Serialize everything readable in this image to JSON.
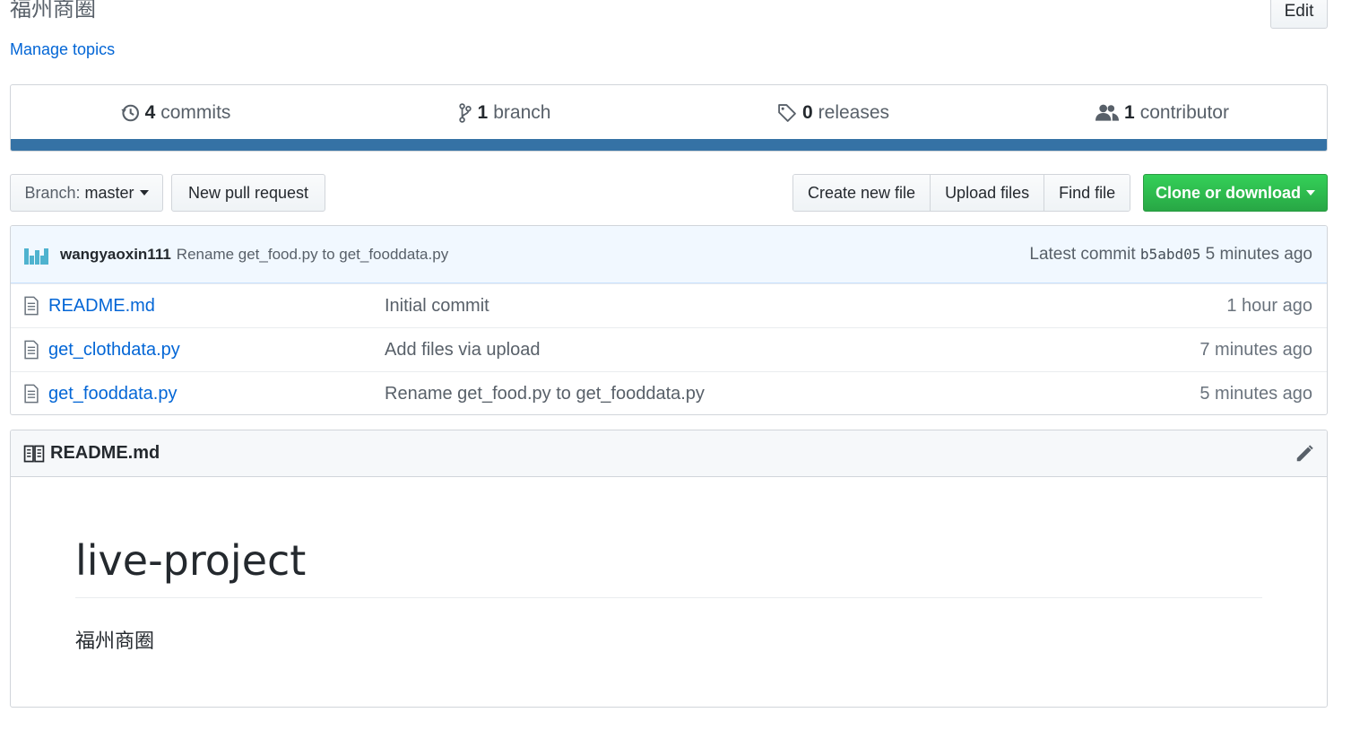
{
  "repo": {
    "description": "福州商圈",
    "edit_label": "Edit",
    "manage_topics": "Manage topics"
  },
  "summary": {
    "commits": {
      "count": "4",
      "label": "commits",
      "icon": "history-icon"
    },
    "branches": {
      "count": "1",
      "label": "branch",
      "icon": "branch-icon"
    },
    "releases": {
      "count": "0",
      "label": "releases",
      "icon": "tag-icon"
    },
    "contributors": {
      "count": "1",
      "label": "contributor",
      "icon": "people-icon"
    },
    "language_color": "#3572a5"
  },
  "toolbar": {
    "branch_prefix": "Branch:",
    "branch_name": "master",
    "new_pull_request": "New pull request",
    "create_new_file": "Create new file",
    "upload_files": "Upload files",
    "find_file": "Find file",
    "clone_or_download": "Clone or download",
    "clone_color": "#28a745"
  },
  "latest_commit": {
    "author": "wangyaoxin111",
    "message": "Rename get_food.py to get_fooddata.py",
    "prefix": "Latest commit",
    "sha": "b5abd05",
    "age": "5 minutes ago"
  },
  "files": [
    {
      "name": "README.md",
      "message": "Initial commit",
      "age": "1 hour ago"
    },
    {
      "name": "get_clothdata.py",
      "message": "Add files via upload",
      "age": "7 minutes ago"
    },
    {
      "name": "get_fooddata.py",
      "message": "Rename get_food.py to get_fooddata.py",
      "age": "5 minutes ago"
    }
  ],
  "readme": {
    "filename": "README.md",
    "heading": "live-project",
    "paragraph": "福州商圈"
  }
}
